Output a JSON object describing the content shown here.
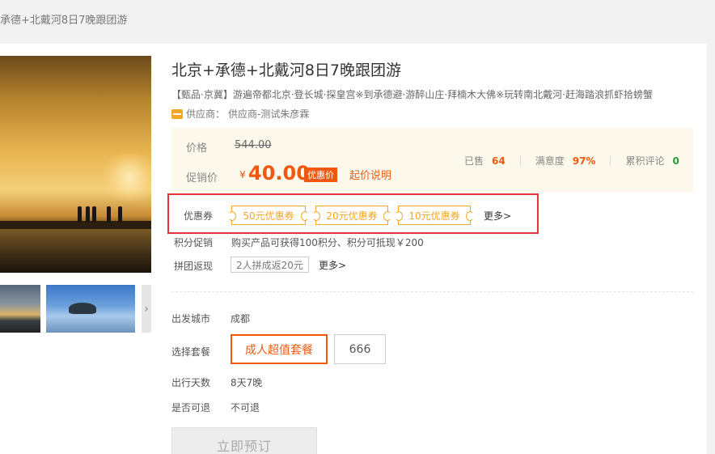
{
  "breadcrumb": "承德+北戴河8日7晚跟团游",
  "product": {
    "title": "北京+承德+北戴河8日7晚跟团游",
    "subtitle": "【甄品·京冀】游遍帝都北京·登长城·探皇宫※到承德避·游醉山庄·拜楠木大佛※玩转南北戴河·赶海踏浪抓虾拾螃蟹",
    "supplier_label": "供应商：",
    "supplier_name": "供应商-测试朱彦霖"
  },
  "price": {
    "price_label": "价格",
    "original": "544.00",
    "promo_label": "促销价",
    "currency": "¥",
    "promo_value": "40.00",
    "promo_badge": "优惠价",
    "note_link": "起价说明"
  },
  "stats": {
    "sold_label": "已售",
    "sold_value": "64",
    "satisfaction_label": "满意度",
    "satisfaction_value": "97%",
    "reviews_label": "累积评论",
    "reviews_value": "0"
  },
  "coupons": {
    "label": "优惠券",
    "items": [
      "50元优惠券",
      "20元优惠券",
      "10元优惠券"
    ],
    "more": "更多>"
  },
  "points": {
    "label": "积分促销",
    "value": "购买产品可获得100积分、积分可抵现￥200"
  },
  "group": {
    "label": "拼团返现",
    "tag": "2人拼成返20元",
    "more": "更多>"
  },
  "departure": {
    "label": "出发城市",
    "value": "成都"
  },
  "packages": {
    "label": "选择套餐",
    "items": [
      "成人超值套餐",
      "666"
    ],
    "selected_index": 0
  },
  "duration": {
    "label": "出行天数",
    "value": "8天7晚"
  },
  "refund": {
    "label": "是否可退",
    "value": "不可退"
  },
  "book_button": "立即预订",
  "colors": {
    "accent": "#f0590d",
    "coupon": "#f5a623",
    "highlight_frame": "#e5353b",
    "price_bg": "#fdf8ec"
  }
}
